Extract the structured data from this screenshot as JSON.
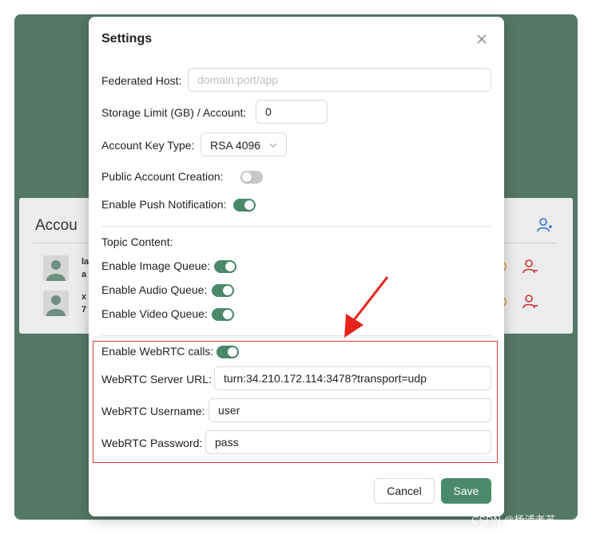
{
  "background": {
    "card_title": "Accou",
    "rows": [
      {
        "handle_line1": "la",
        "handle_line2": "a"
      },
      {
        "handle_line1": "x",
        "handle_line2": "7"
      }
    ]
  },
  "modal": {
    "title": "Settings",
    "fields": {
      "federated_host": {
        "label": "Federated Host:",
        "value": "",
        "placeholder": "domain:port/app"
      },
      "storage_limit": {
        "label": "Storage Limit (GB) / Account:",
        "value": "0"
      },
      "account_key_type": {
        "label": "Account Key Type:",
        "selected": "RSA 4096"
      },
      "public_account_creation": {
        "label": "Public Account Creation:",
        "enabled": false
      },
      "push_notification": {
        "label": "Enable Push Notification:",
        "enabled": true
      },
      "topic_content": {
        "label": "Topic Content:"
      },
      "image_queue": {
        "label": "Enable Image Queue:",
        "enabled": true
      },
      "audio_queue": {
        "label": "Enable Audio Queue:",
        "enabled": true
      },
      "video_queue": {
        "label": "Enable Video Queue:",
        "enabled": true
      },
      "webrtc_calls": {
        "label": "Enable WebRTC calls:",
        "enabled": true
      },
      "webrtc_url": {
        "label": "WebRTC Server URL:",
        "value": "turn:34.210.172.114:3478?transport=udp"
      },
      "webrtc_username": {
        "label": "WebRTC Username:",
        "value": "user"
      },
      "webrtc_password": {
        "label": "WebRTC Password:",
        "value": "pass"
      }
    },
    "buttons": {
      "cancel": "Cancel",
      "save": "Save"
    }
  },
  "watermark": "CSDN @杨浦老苏",
  "colors": {
    "frame_bg": "#557766",
    "accent": "#4a8a6a",
    "highlight": "#e03c31",
    "icon_blue": "#2f6fd6",
    "icon_red": "#c9302c"
  },
  "icons": [
    "add-user-icon",
    "remove-user-icon",
    "close-icon",
    "chevron-down-icon",
    "avatar-icon",
    "arrow-annotation-icon"
  ]
}
